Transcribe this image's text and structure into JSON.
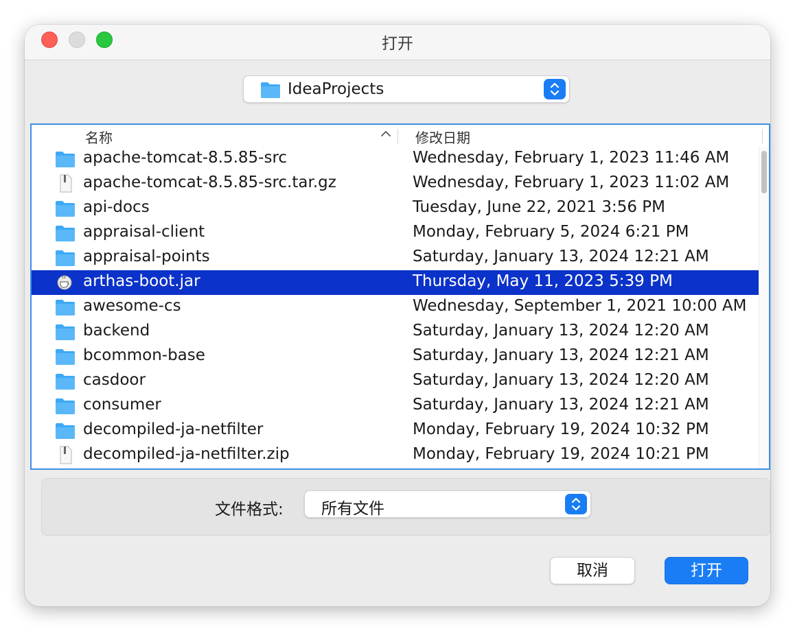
{
  "window": {
    "title": "打开"
  },
  "location": {
    "current_folder": "IdeaProjects",
    "folder_icon": "folder-icon"
  },
  "file_list": {
    "columns": {
      "name": "名称",
      "date_modified": "修改日期"
    },
    "sort": {
      "column": "name",
      "direction": "ascending"
    },
    "rows": [
      {
        "name": "apache-tomcat-8.5.85-src",
        "date": "Wednesday, February 1, 2023 11:46 AM",
        "type": "folder",
        "selected": false
      },
      {
        "name": "apache-tomcat-8.5.85-src.tar.gz",
        "date": "Wednesday, February 1, 2023 11:02 AM",
        "type": "file",
        "selected": false
      },
      {
        "name": "api-docs",
        "date": "Tuesday, June 22, 2021 3:56 PM",
        "type": "folder",
        "selected": false
      },
      {
        "name": "appraisal-client",
        "date": "Monday, February 5, 2024 6:21 PM",
        "type": "folder",
        "selected": false
      },
      {
        "name": "appraisal-points",
        "date": "Saturday, January 13, 2024 12:21 AM",
        "type": "folder",
        "selected": false
      },
      {
        "name": "arthas-boot.jar",
        "date": "Thursday, May 11, 2023 5:39 PM",
        "type": "jar",
        "selected": true
      },
      {
        "name": "awesome-cs",
        "date": "Wednesday, September 1, 2021 10:00 AM",
        "type": "folder",
        "selected": false
      },
      {
        "name": "backend",
        "date": "Saturday, January 13, 2024 12:20 AM",
        "type": "folder",
        "selected": false
      },
      {
        "name": "bcommon-base",
        "date": "Saturday, January 13, 2024 12:21 AM",
        "type": "folder",
        "selected": false
      },
      {
        "name": "casdoor",
        "date": "Saturday, January 13, 2024 12:20 AM",
        "type": "folder",
        "selected": false
      },
      {
        "name": "consumer",
        "date": "Saturday, January 13, 2024 12:21 AM",
        "type": "folder",
        "selected": false
      },
      {
        "name": "decompiled-ja-netfilter",
        "date": "Monday, February 19, 2024 10:32 PM",
        "type": "folder",
        "selected": false
      },
      {
        "name": "decompiled-ja-netfilter.zip",
        "date": "Monday, February 19, 2024 10:21 PM",
        "type": "file",
        "selected": false
      }
    ]
  },
  "file_format": {
    "label": "文件格式:",
    "selected": "所有文件"
  },
  "buttons": {
    "cancel": "取消",
    "open": "打开"
  },
  "colors": {
    "accent": "#1a7df5",
    "selection": "#0b32c9",
    "folder": "#3fa9f5",
    "close": "#fe5f57",
    "minimize": "#dcdcdc",
    "maximize": "#28c840"
  }
}
